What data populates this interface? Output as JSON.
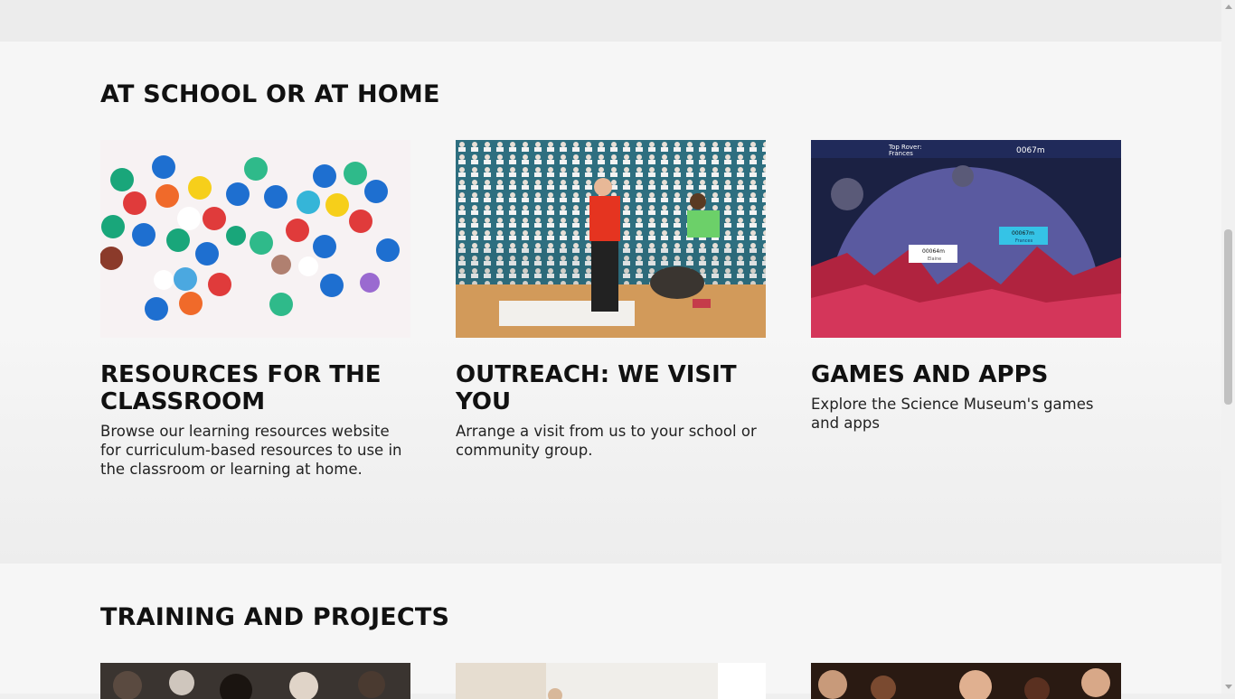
{
  "sections": [
    {
      "title": "AT SCHOOL OR AT HOME",
      "cards": [
        {
          "title": "RESOURCES FOR THE CLASSROOM",
          "description": "Browse our learning resources website for curriculum-based resources to use in the classroom or learning at home.",
          "image": "colourful-letter-discs"
        },
        {
          "title": "OUTREACH: WE VISIT YOU",
          "description": "Arrange a visit from us to your school or community group.",
          "image": "science-show-audience"
        },
        {
          "title": "GAMES AND APPS",
          "description": "Explore the Science Museum's games and apps",
          "image": "space-rover-game"
        }
      ]
    },
    {
      "title": "TRAINING AND PROJECTS",
      "cards": [
        {
          "image": "training-group-photo"
        },
        {
          "image": "workshop-photo"
        },
        {
          "image": "children-audience-photo"
        }
      ]
    }
  ],
  "game_hud": {
    "top_rover_label": "Top Rover:",
    "top_rover_name": "Frances",
    "distance": "0067m",
    "marker_1_distance": "00064m",
    "marker_1_name": "Elaine",
    "marker_2_distance": "00067m",
    "marker_2_name": "Frances"
  },
  "colors": {
    "section_bg": "#f6f6f6",
    "band_bg": "#ececec",
    "text": "#111111"
  }
}
